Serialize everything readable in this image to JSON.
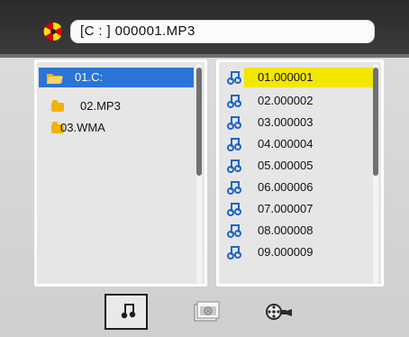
{
  "title_bar": {
    "path_text": "[C : ]   000001.MP3"
  },
  "left_panel": {
    "items": [
      {
        "label": "01.C:",
        "icon": "open-folder-icon",
        "selected": true
      },
      {
        "label": "02.MP3",
        "icon": "folder-icon",
        "selected": false
      },
      {
        "label": "03.WMA",
        "icon": "folder-icon",
        "selected": false
      }
    ]
  },
  "right_panel": {
    "items": [
      {
        "label": "01.000001",
        "icon": "music-note-icon",
        "selected": true
      },
      {
        "label": "02.000002",
        "icon": "music-note-icon",
        "selected": false
      },
      {
        "label": "03.000003",
        "icon": "music-note-icon",
        "selected": false
      },
      {
        "label": "04.000004",
        "icon": "music-note-icon",
        "selected": false
      },
      {
        "label": "05.000005",
        "icon": "music-note-icon",
        "selected": false
      },
      {
        "label": "06.000006",
        "icon": "music-note-icon",
        "selected": false
      },
      {
        "label": "07.000007",
        "icon": "music-note-icon",
        "selected": false
      },
      {
        "label": "08.000008",
        "icon": "music-note-icon",
        "selected": false
      },
      {
        "label": "09.000009",
        "icon": "music-note-icon",
        "selected": false
      }
    ]
  },
  "bottom_tabs": [
    {
      "name": "music-tab",
      "icon": "music-note-icon",
      "active": true
    },
    {
      "name": "photo-tab",
      "icon": "photo-stack-icon",
      "active": false
    },
    {
      "name": "video-tab",
      "icon": "film-camera-icon",
      "active": false
    }
  ],
  "colors": {
    "title_bg": "#2f2f2f",
    "left_selected": "#2b74d8",
    "right_selected": "#f3e600",
    "music_icon": "#1f63c9"
  }
}
